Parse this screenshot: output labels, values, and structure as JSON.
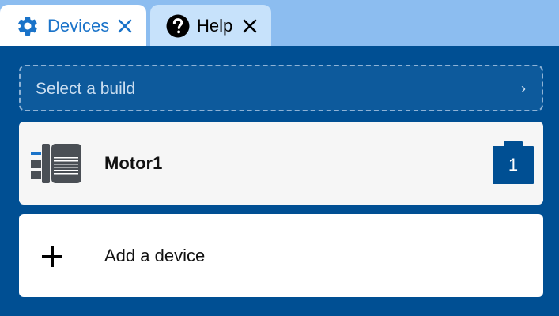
{
  "tabs": [
    {
      "label": "Devices",
      "icon": "gear-icon",
      "active": true
    },
    {
      "label": "Help",
      "icon": "help-icon",
      "active": false
    }
  ],
  "build_select": {
    "placeholder": "Select a build",
    "chevron": "›"
  },
  "devices": [
    {
      "name": "Motor1",
      "icon": "motor-icon",
      "port": "1"
    }
  ],
  "add_device": {
    "label": "Add a device",
    "icon": "plus-icon"
  },
  "colors": {
    "tabbar_bg": "#8cbdf0",
    "active_tab_bg": "#ffffff",
    "inactive_tab_bg": "#c7e2fb",
    "panel_bg": "#004f93",
    "accent": "#1a73c9",
    "port_badge": "#004f93"
  }
}
